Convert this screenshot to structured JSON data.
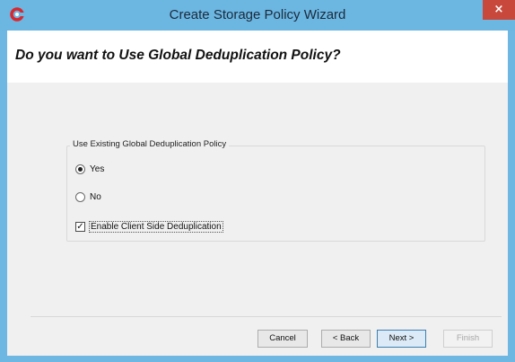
{
  "window": {
    "title": "Create Storage Policy Wizard",
    "close_label": "×",
    "app_icon": "commvault-logo-icon",
    "accent_color": "#6cb6e2"
  },
  "page": {
    "heading": "Do you want to Use Global Deduplication Policy?"
  },
  "group": {
    "label": "Use Existing Global Deduplication Policy",
    "options": [
      {
        "label": "Yes",
        "selected": true
      },
      {
        "label": "No",
        "selected": false
      }
    ],
    "client_side_dedup": {
      "label": "Enable Client Side Deduplication",
      "checked": true
    }
  },
  "buttons": {
    "cancel": "Cancel",
    "back": "< Back",
    "next": "Next >",
    "finish": "Finish"
  }
}
